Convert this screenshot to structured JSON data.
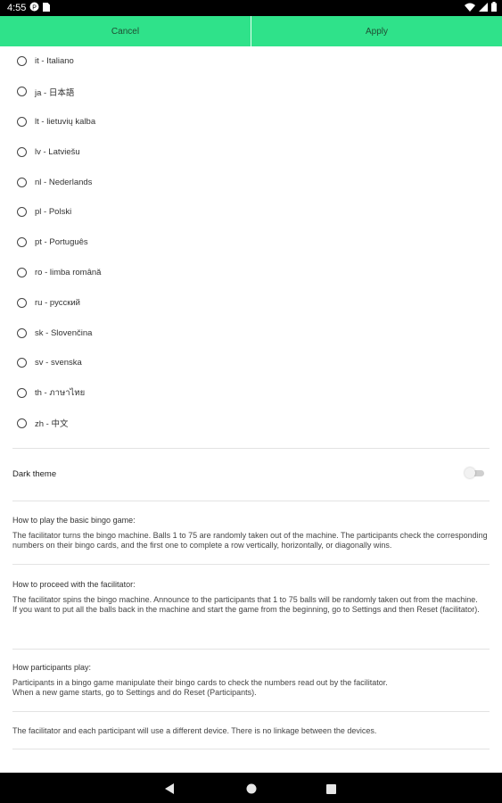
{
  "status_bar": {
    "time": "4:55",
    "left_icons": [
      "notification-p-icon",
      "sim-card-icon"
    ],
    "right_icons": [
      "wifi-icon",
      "signal-icon",
      "battery-icon"
    ]
  },
  "actions": {
    "cancel_label": "Cancel",
    "apply_label": "Apply"
  },
  "languages": [
    "it - Italiano",
    "ja - 日本語",
    "lt - lietuvių kalba",
    "lv - Latviešu",
    "nl - Nederlands",
    "pl - Polski",
    "pt - Português",
    "ro - limba română",
    "ru - русский",
    "sk - Slovenčina",
    "sv - svenska",
    "th - ภาษาไทย",
    "zh - 中文"
  ],
  "settings": {
    "dark_theme_label": "Dark theme",
    "dark_theme_on": false
  },
  "help": {
    "basic_title": "How to play the basic bingo game:",
    "basic_text": "The facilitator turns the bingo machine. Balls 1 to 75 are randomly taken out of the machine. The participants check the corresponding numbers on their bingo cards, and the first one to complete a row vertically, horizontally, or diagonally wins.",
    "facilitator_title": "How to proceed with the facilitator:",
    "facilitator_text_1": "The facilitator spins the bingo machine. Announce to the participants that 1 to 75 balls will be randomly taken out from the machine.",
    "facilitator_text_2": "If you want to put all the balls back in the machine and start the game from the beginning, go to Settings and then Reset (facilitator).",
    "participants_title": "How participants play:",
    "participants_text_1": "Participants in a bingo game manipulate their bingo cards to check the numbers read out by the facilitator.",
    "participants_text_2": "When a new game starts, go to Settings and do Reset (Participants).",
    "devices_text": "The facilitator and each participant will use a different device. There is no linkage between the devices."
  },
  "nav_icons": [
    "back-icon",
    "home-icon",
    "recents-icon"
  ]
}
